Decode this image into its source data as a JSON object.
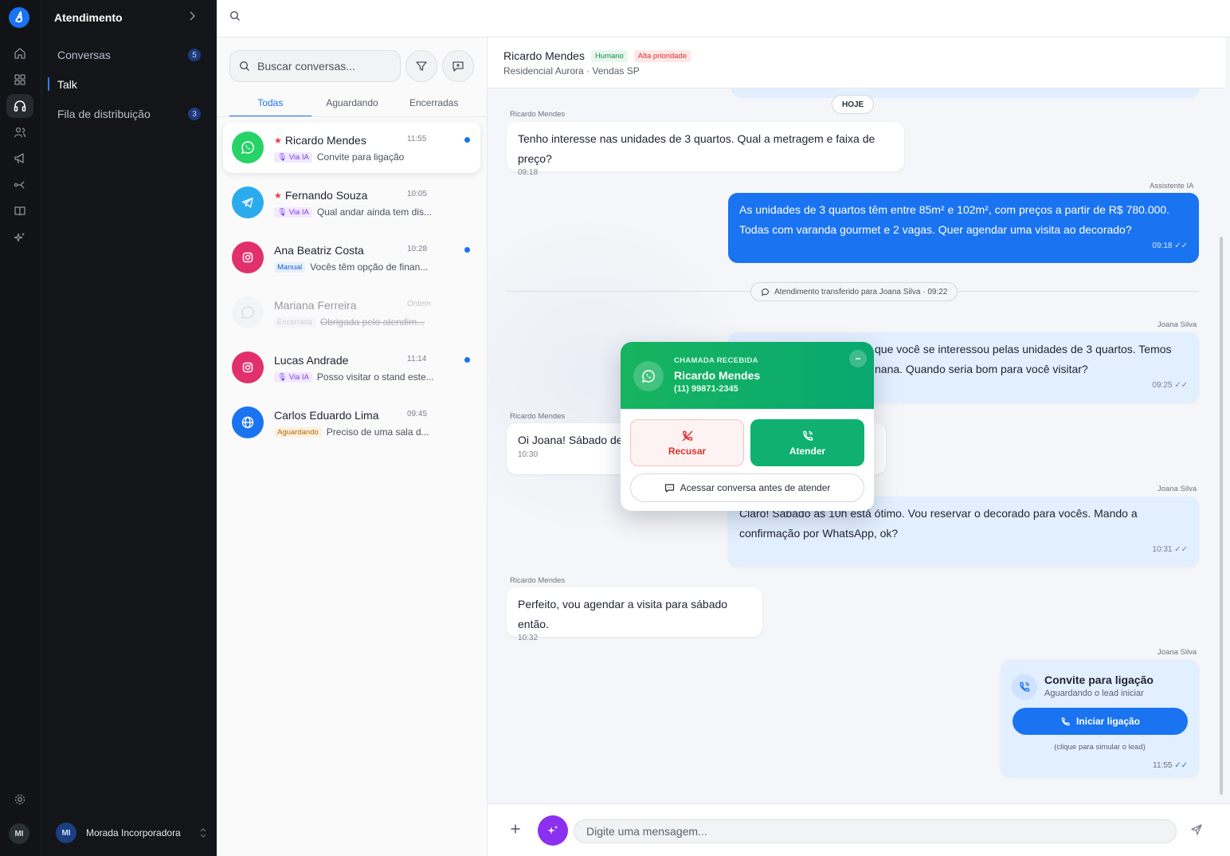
{
  "app": {
    "section_title": "Atendimento",
    "user_initials": "MI"
  },
  "sidebar": {
    "items": [
      {
        "label": "Conversas",
        "badge": "5"
      },
      {
        "label": "Talk"
      },
      {
        "label": "Fila de distribuição",
        "badge": "3"
      }
    ],
    "workspace": {
      "initials": "MI",
      "name": "Morada Incorporadora"
    }
  },
  "conversations": {
    "search_placeholder": "Buscar conversas...",
    "tabs": [
      "Todas",
      "Aguardando",
      "Encerradas"
    ],
    "items": [
      {
        "name": "Ricardo Mendes",
        "time": "11:55",
        "tag": "Via IA",
        "preview": "Convite para ligação",
        "channel": "whatsapp",
        "starred": true,
        "unread": true
      },
      {
        "name": "Fernando Souza",
        "time": "10:05",
        "tag": "Via IA",
        "preview": "Qual andar ainda tem dis...",
        "channel": "telegram",
        "starred": true,
        "unread": false
      },
      {
        "name": "Ana Beatriz Costa",
        "time": "10:28",
        "tag": "Manual",
        "preview": "Vocês têm opção de finan...",
        "channel": "instagram",
        "starred": false,
        "unread": true
      },
      {
        "name": "Mariana Ferreira",
        "time": "Ontem",
        "tag": "Encerrada",
        "preview": "Obrigada pelo atendim...",
        "channel": "whatsapp",
        "starred": false,
        "unread": false
      },
      {
        "name": "Lucas Andrade",
        "time": "11:14",
        "tag": "Via IA",
        "preview": "Posso visitar o stand este...",
        "channel": "instagram",
        "starred": false,
        "unread": true
      },
      {
        "name": "Carlos Eduardo Lima",
        "time": "09:45",
        "tag": "Aguardando",
        "preview": "Preciso de uma sala d...",
        "channel": "web",
        "starred": false,
        "unread": false
      }
    ]
  },
  "chat": {
    "contact_name": "Ricardo Mendes",
    "tag_mode": "Humano",
    "tag_priority": "Alta prioridade",
    "subtitle": "Residencial Aurora · Vendas SP",
    "date_divider": "HOJE",
    "messages": [
      {
        "sender": "Ricardo Mendes",
        "text": "Tenho interesse nas unidades de 3 quartos. Qual a metragem e faixa de preço?",
        "time": "09:18"
      },
      {
        "sender": "Assistente IA",
        "text": "As unidades de 3 quartos têm entre 85m² e 102m², com preços a partir de R$ 780.000. Todas com varanda gourmet e 2 vagas. Quer agendar uma visita ao decorado?",
        "time": "09:18"
      },
      {
        "sender": "Joana Silva",
        "text_line1": "que você se interessou pelas unidades de 3 quartos. Temos",
        "text_line2": "nana. Quando seria bom para você visitar?",
        "time": "09:25"
      },
      {
        "sender": "Ricardo Mendes",
        "text": "Oi Joana! Sábado de",
        "time": "10:30"
      },
      {
        "sender": "Joana Silva",
        "text": "Claro! Sábado às 10h está ótimo. Vou reservar o decorado para vocês. Mando a confirmação por WhatsApp, ok?",
        "time": "10:31"
      },
      {
        "sender": "Ricardo Mendes",
        "text": "Perfeito, vou agendar a visita para sábado então.",
        "time": "10:32"
      },
      {
        "sender": "Joana Silva",
        "time": "11:55"
      }
    ],
    "system_event": "Atendimento transferido para Joana Silva · 09:22",
    "call_invite": {
      "title": "Convite para ligação",
      "status": "Aguardando o lead iniciar",
      "button": "Iniciar ligação",
      "hint": "(clique para simular o lead)"
    },
    "composer_placeholder": "Digite uma mensagem..."
  },
  "incoming_call": {
    "label": "CHAMADA RECEBIDA",
    "name": "Ricardo Mendes",
    "phone": "(11) 99871-2345",
    "decline": "Recusar",
    "accept": "Atender",
    "open_chat": "Acessar conversa antes de atender"
  },
  "colors": {
    "accent": "#1a73f0",
    "whatsapp": "#25d366",
    "instagram": "#e1306c",
    "telegram": "#2aabee",
    "ai": "#8b2ff0",
    "accept": "#0fb070",
    "decline": "#e03131"
  }
}
